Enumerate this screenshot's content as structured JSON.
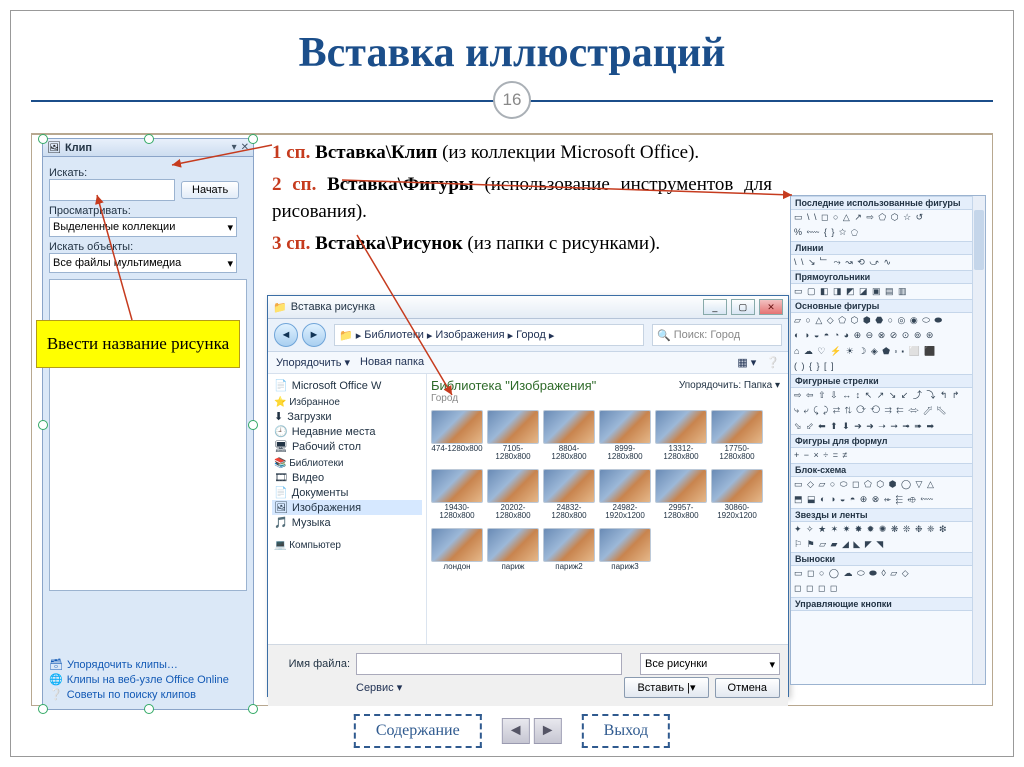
{
  "slide": {
    "title": "Вставка иллюстраций",
    "page": "16",
    "text1_num": "1 сп.",
    "text1_bold": "Вставка\\Клип",
    "text1_rest": " (из коллекции Microsoft Office).",
    "text2_num": "2 сп.",
    "text2_bold": "Вставка\\Фигуры",
    "text2_rest": " (использование инструментов для рисования).",
    "text3_num": "3 сп.",
    "text3_bold": "Вставка\\Рисунок",
    "text3_rest": " (из папки с рисунками).",
    "callout": "Ввести название рисунка",
    "nav_contents": "Содержание",
    "nav_exit": "Выход"
  },
  "clip": {
    "title": "Клип",
    "lbl_search": "Искать:",
    "btn_start": "Начать",
    "lbl_browse": "Просматривать:",
    "combo_browse": "Выделенные коллекции",
    "lbl_types": "Искать объекты:",
    "combo_types": "Все файлы мультимедиа",
    "link1": "Упорядочить клипы…",
    "link2": "Клипы на веб-узле Office Online",
    "link3": "Советы по поиску клипов"
  },
  "dlg": {
    "title": "Вставка рисунка",
    "crumbs": [
      "Библиотеки",
      "Изображения",
      "Город"
    ],
    "search_placeholder": "Поиск: Город",
    "tb_organize": "Упорядочить ▾",
    "tb_newfolder": "Новая папка",
    "side_ms": "Microsoft Office W",
    "side_fav": "Избранное",
    "side_fav_items": [
      "Загрузки",
      "Недавние места",
      "Рабочий стол"
    ],
    "side_lib": "Библиотеки",
    "side_lib_items": [
      "Видео",
      "Документы",
      "Изображения",
      "Музыка"
    ],
    "side_computer": "Компьютер",
    "lib_header": "Библиотека \"Изображения\"",
    "lib_sub": "Город",
    "sortby": "Упорядочить: Папка ▾",
    "files": [
      "474-1280x800",
      "7105-1280x800",
      "8804-1280x800",
      "8999-1280x800",
      "13312-1280x800",
      "17750-1280x800",
      "19430-1280x800",
      "20202-1280x800",
      "24832-1280x800",
      "24982-1920x1200",
      "29957-1280x800",
      "30860-1920x1200",
      "лондон",
      "париж",
      "париж2",
      "париж3"
    ],
    "lbl_filename": "Имя файла:",
    "sel_filter": "Все рисунки",
    "lbl_service": "Сервис ▾",
    "btn_insert": "Вставить",
    "btn_cancel": "Отмена"
  },
  "gallery": {
    "cats": [
      "Последние использованные фигуры",
      "Линии",
      "Прямоугольники",
      "Основные фигуры",
      "Фигурные стрелки",
      "Фигуры для формул",
      "Блок-схема",
      "Звезды и ленты",
      "Выноски",
      "Управляющие кнопки"
    ],
    "rows": {
      "recent": "▭ \\ \\ ◻ ○ △ ↗ ⇨ ⬠ ⬡ ☆ ↺",
      "recent2": "% ⬳ { } ☆ ⬠",
      "lines": "\\ \\ ↘ ﹂ ⤳ ↝ ⟲ ⤻ ∿",
      "rects": "▭ ▢ ◧ ◨ ◩ ◪ ▣ ▤ ▥",
      "basic1": "▱ ○ △ ◇ ⬠ ⬡ ⬢ ⬣ ○ ◎ ◉ ⬭ ⬬",
      "basic2": "◐ ◑ ◒ ◓ ◔ ◕ ⊕ ⊖ ⊗ ⊘ ⊙ ⊚ ⊛",
      "basic3": "⌂ ☁ ♡ ⚡ ☀ ☽ ◈ ⬟ ⬞ ⬝ ⬜ ⬛",
      "basic4": "( ) { } [ ]",
      "arrows1": "⇨ ⇦ ⇧ ⇩ ↔ ↕ ↖ ↗ ↘ ↙ ⤴ ⤵ ↰ ↱",
      "arrows2": "⤷ ⤶ ⤹ ⤸ ⇄ ⇅ ⟳ ⟲ ⇉ ⇇ ⬄ ⬀ ⬁",
      "arrows3": "⬂ ⬃ ⬅ ⬆ ⬇ ➔ ➜ ➝ ➞ ➟ ➠ ➡",
      "formula": "+ − × ÷ = ≠",
      "flow1": "▭ ◇ ▱ ○ ⬭ ◻ ⬠ ⬡ ⬢ ◯ ▽ △",
      "flow2": "⬒ ⬓ ◐ ◑ ◒ ◓ ⊕ ⊗ ⬰ ⬱ ⬲ ⬳",
      "stars1": "✦ ✧ ★ ✶ ✷ ✸ ✹ ✺ ❋ ❊ ❉ ❈ ❇",
      "stars2": "⚐ ⚑ ▱ ▰ ◢ ◣ ◤ ◥",
      "callouts1": "▭ ◻ ○ ◯ ☁ ⬭ ⬬ ◊ ▱ ◇",
      "callouts2": "◻ ◻ ◻ ◻"
    }
  }
}
